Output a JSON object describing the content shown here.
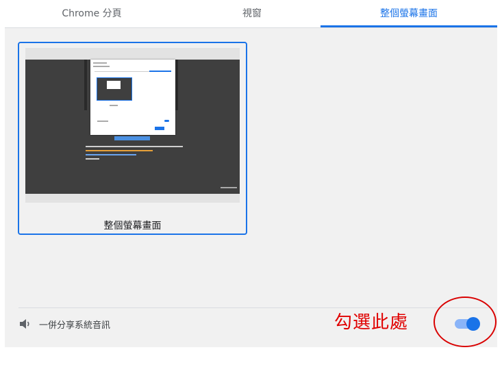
{
  "tabs": [
    {
      "label": "Chrome 分頁",
      "active": false
    },
    {
      "label": "視窗",
      "active": false
    },
    {
      "label": "整個螢幕畫面",
      "active": true
    }
  ],
  "screen_option": {
    "label": "整個螢幕畫面",
    "selected": true
  },
  "audio": {
    "icon": "speaker-icon",
    "label": "一併分享系統音訊",
    "toggle_on": true
  },
  "annotation": {
    "text": "勾選此處",
    "color": "#e00000"
  },
  "colors": {
    "accent": "#1a73e8",
    "panel_bg": "#f1f1f1"
  }
}
